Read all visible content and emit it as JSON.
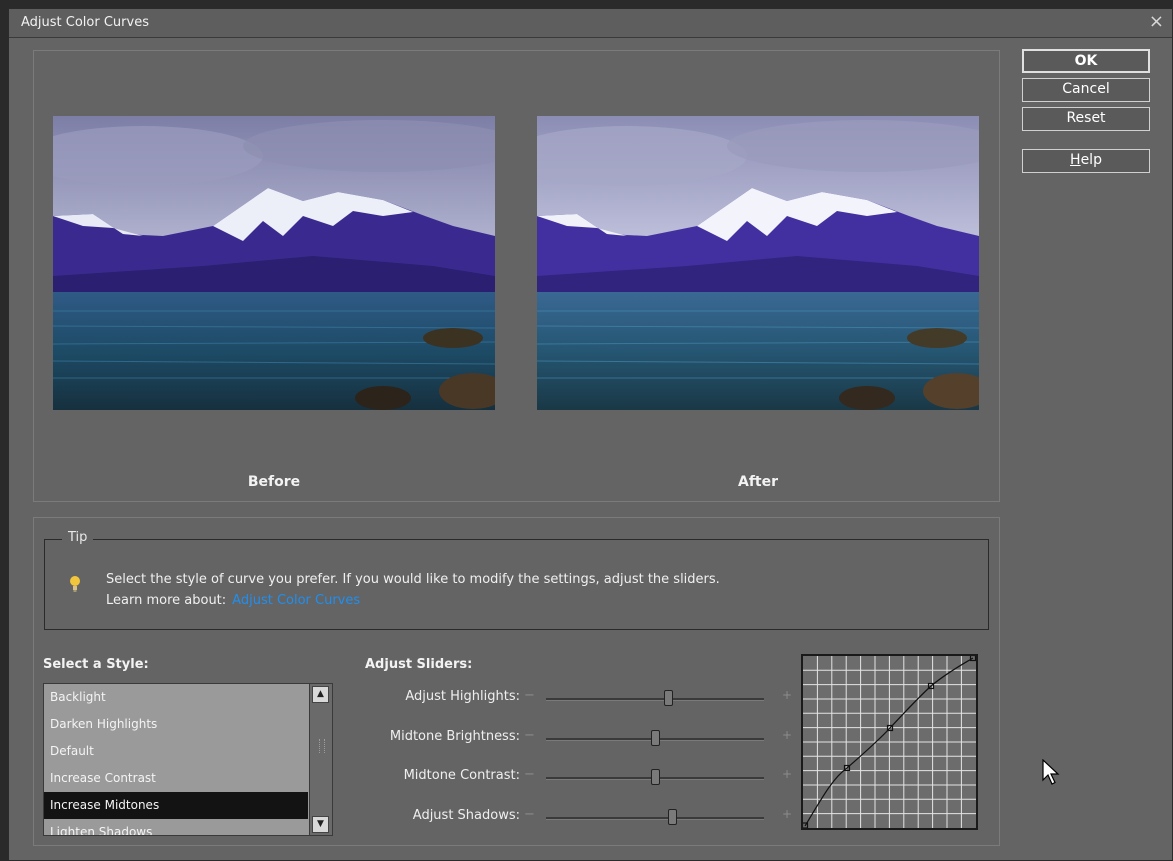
{
  "window": {
    "title": "Adjust Color Curves",
    "close_glyph": "×"
  },
  "preview": {
    "before_label": "Before",
    "after_label": "After"
  },
  "tip": {
    "legend": "Tip",
    "line1": "Select the style of curve you prefer. If you would like to modify the settings, adjust the sliders.",
    "learn_more": "Learn more about:",
    "link_text": "Adjust Color Curves"
  },
  "style_section": {
    "label": "Select a Style:",
    "items": [
      "Backlight",
      "Darken Highlights",
      "Default",
      "Increase Contrast",
      "Increase Midtones",
      "Lighten Shadows"
    ],
    "selected": "Increase Midtones"
  },
  "sliders_section": {
    "label": "Adjust Sliders:",
    "minus_glyph": "−",
    "plus_glyph": "+",
    "sliders": [
      {
        "label": "Adjust Highlights:",
        "value": 0.56
      },
      {
        "label": "Midtone Brightness:",
        "value": 0.5
      },
      {
        "label": "Midtone Contrast:",
        "value": 0.5
      },
      {
        "label": "Adjust Shadows:",
        "value": 0.58
      }
    ]
  },
  "buttons": {
    "ok": "OK",
    "cancel": "Cancel",
    "reset": "Reset",
    "help_mnemonic": "H",
    "help_rest": "elp"
  },
  "colors": {
    "dialog_bg": "#646464",
    "link": "#1f8ff0",
    "selected_row": "#131313",
    "list_bg": "#9a9a9a"
  },
  "icons": [
    "close-icon",
    "lightbulb-icon",
    "scroll-up-icon",
    "scroll-down-icon",
    "mouse-cursor-icon"
  ]
}
